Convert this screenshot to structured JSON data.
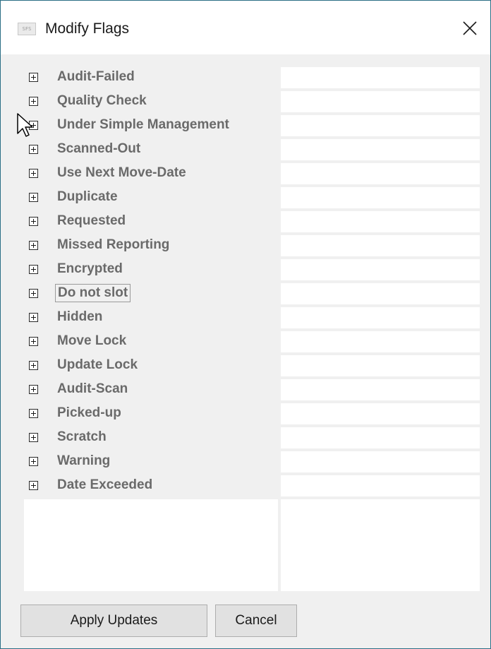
{
  "window": {
    "title": "Modify Flags",
    "app_icon_text": "SFS",
    "close_glyph": "✕"
  },
  "flags": [
    {
      "label": "Audit-Failed",
      "value": ""
    },
    {
      "label": "Quality Check",
      "value": ""
    },
    {
      "label": "Under Simple Management",
      "value": ""
    },
    {
      "label": "Scanned-Out",
      "value": ""
    },
    {
      "label": "Use Next Move-Date",
      "value": ""
    },
    {
      "label": "Duplicate",
      "value": ""
    },
    {
      "label": "Requested",
      "value": ""
    },
    {
      "label": "Missed Reporting",
      "value": ""
    },
    {
      "label": "Encrypted",
      "value": ""
    },
    {
      "label": "Do not slot",
      "value": ""
    },
    {
      "label": "Hidden",
      "value": ""
    },
    {
      "label": "Move Lock",
      "value": ""
    },
    {
      "label": "Update Lock",
      "value": ""
    },
    {
      "label": "Audit-Scan",
      "value": ""
    },
    {
      "label": "Picked-up",
      "value": ""
    },
    {
      "label": "Scratch",
      "value": ""
    },
    {
      "label": "Warning",
      "value": ""
    },
    {
      "label": "Date Exceeded",
      "value": ""
    }
  ],
  "focused_flag_index": 9,
  "buttons": {
    "apply": "Apply Updates",
    "cancel": "Cancel"
  },
  "colors": {
    "border_accent": "#2b6f86",
    "label_text": "#6a6a6a",
    "button_face": "#e1e1e1"
  },
  "icons": {
    "expander": "plus-box-icon",
    "close": "close-icon",
    "cursor": "mouse-pointer-icon"
  }
}
